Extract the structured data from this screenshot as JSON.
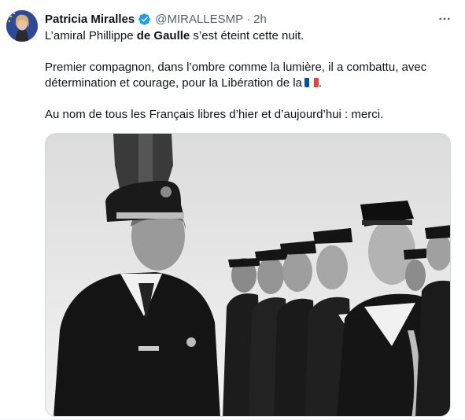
{
  "author": {
    "name": "Patricia Miralles",
    "handle": "@MIRALLESMP",
    "separator": "·",
    "time": "2h"
  },
  "body": {
    "line1_prefix": "L’amiral Phillippe ",
    "line1_bold": "de Gaulle",
    "line1_suffix": " s’est éteint cette nuit.",
    "para2": "Premier compagnon, dans l’ombre comme la lumière, il a combattu, avec détermination et courage, pour la Libération de la",
    "para3": "Au nom de tous les Français libres d’hier et d’aujourd’hui : merci."
  },
  "icons": {
    "verified": "verified-badge-icon",
    "more": "more-horizontal-icon",
    "flag": "france-flag-icon"
  },
  "colors": {
    "verified_blue": "#1d9bf0",
    "secondary_text": "#536471",
    "flag_blue": "#0055a4",
    "flag_red": "#ef4135"
  }
}
